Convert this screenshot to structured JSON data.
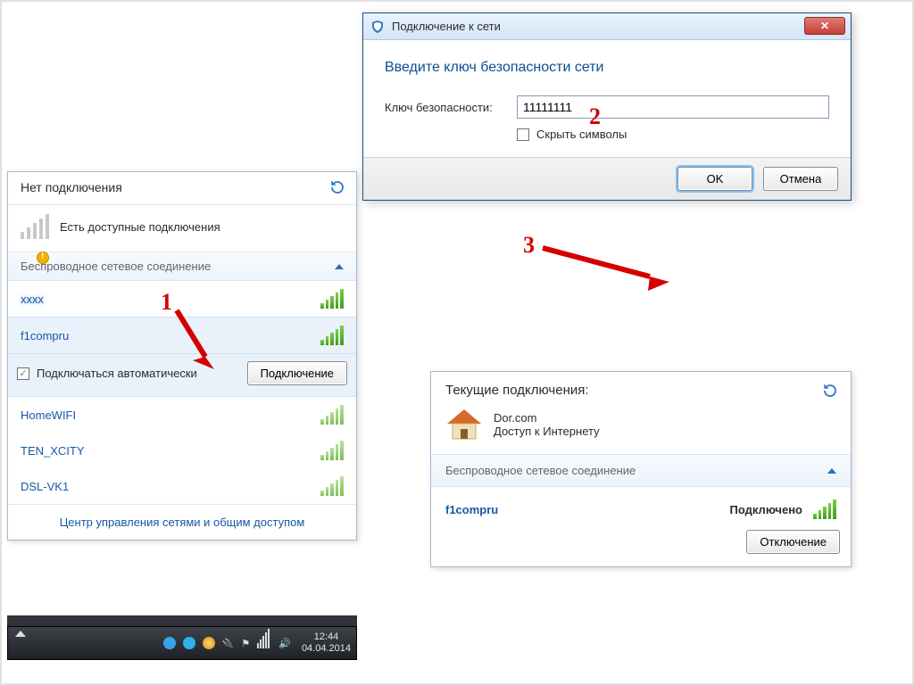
{
  "annotations": {
    "n1": "1",
    "n2": "2",
    "n3": "3"
  },
  "netPopup": {
    "title": "Нет подключения",
    "status": "Есть доступные подключения",
    "sectionLabel": "Беспроводное сетевое соединение",
    "hiddenSSID": "xxxx",
    "networks": [
      {
        "name": "f1compru"
      },
      {
        "name": "HomeWIFI"
      },
      {
        "name": "TEN_XCITY"
      },
      {
        "name": "DSL-VK1"
      }
    ],
    "autoConnectLabel": "Подключаться автоматически",
    "connectBtn": "Подключение",
    "footerLink": "Центр управления сетями и общим доступом"
  },
  "taskbar": {
    "time": "12:44",
    "date": "04.04.2014"
  },
  "dialog": {
    "windowTitle": "Подключение к сети",
    "heading": "Введите ключ безопасности сети",
    "keyLabel": "Ключ безопасности:",
    "keyValue": "11111111",
    "hideLabel": "Скрыть символы",
    "ok": "OK",
    "cancel": "Отмена"
  },
  "connPopup": {
    "heading": "Текущие подключения:",
    "networkName": "Dor.com",
    "internetAccess": "Доступ к Интернету",
    "sectionLabel": "Беспроводное сетевое соединение",
    "ssid": "f1compru",
    "status": "Подключено",
    "disconnectBtn": "Отключение"
  }
}
